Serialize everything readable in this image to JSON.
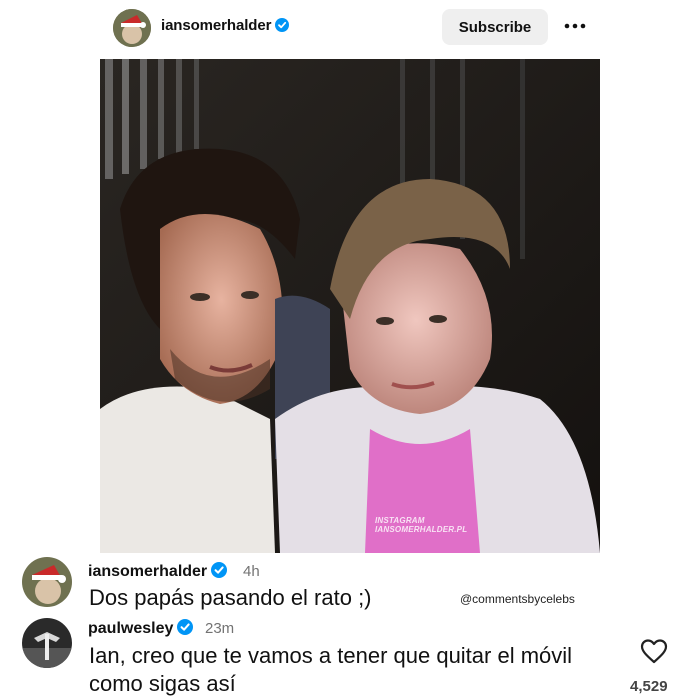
{
  "header": {
    "username": "iansomerhalder",
    "verified_icon": "verified-badge-icon",
    "subscribe_label": "Subscribe",
    "more_icon": "more-options-icon"
  },
  "photo": {
    "watermark_line1": "INSTAGRAM",
    "watermark_line2": "IANSOMERHALDER.PL"
  },
  "comments": [
    {
      "username": "iansomerhalder",
      "time": "4h",
      "text": "Dos papás pasando el rato ;)"
    },
    {
      "username": "paulwesley",
      "time": "23m",
      "text_line1": "Ian, creo que te vamos a tener que quitar el móvil",
      "text_line2": "como sigas así",
      "likes": "4,529"
    }
  ],
  "credit": "@commentsbycelebs",
  "colors": {
    "verified": "#0095f6",
    "subscribe_bg": "#efefef",
    "time_gray": "#737373"
  }
}
